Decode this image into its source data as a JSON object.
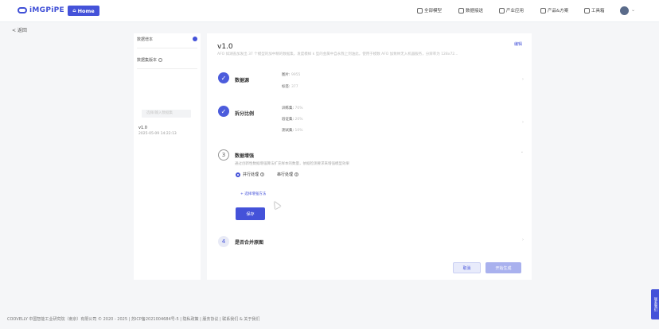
{
  "header": {
    "logo_text": "iMGPiPE",
    "home_label": "Home",
    "nav": [
      {
        "label": "全部模型",
        "icon": "model-icon"
      },
      {
        "label": "数据接送",
        "icon": "data-icon"
      },
      {
        "label": "产业应用",
        "icon": "industry-icon"
      },
      {
        "label": "产品&方案",
        "icon": "product-icon"
      },
      {
        "label": "工具箱",
        "icon": "toolbox-icon"
      }
    ]
  },
  "back_label": "< 返回",
  "sidebar": {
    "item1": "数据增本",
    "item2": "数据集版本",
    "input_placeholder": "选择/输入数据集",
    "version_name": "v1.0",
    "version_time": "2025-05-09 14:22:13"
  },
  "main": {
    "version_title": "v1.0",
    "edit_label": "编辑",
    "description": "AFO 如湖盖加发出 37 个模型的加中精的数据集，发度模样 k 型的金属中自永我上到油此，使用于模数 AFO 加致林无入机器服务，分辨率为 128x72...",
    "steps": [
      {
        "title": "数据源",
        "rows": [
          {
            "k": "图片:",
            "v": "9955"
          },
          {
            "k": "标签:",
            "v": "377"
          }
        ]
      },
      {
        "title": "拆分比例",
        "rows": [
          {
            "k": "训练集:",
            "v": "70%"
          },
          {
            "k": "验证集:",
            "v": "20%"
          },
          {
            "k": "测试集:",
            "v": "10%"
          }
        ]
      },
      {
        "num": "3",
        "title": "数据增强",
        "hint": "通过创新性数据增强算法扩充样本的数量，依据检测要求来增强模型效果"
      },
      {
        "num": "4",
        "title": "是否合并原图"
      }
    ],
    "radio_parallel": "并行处理",
    "radio_serial": "串行处理",
    "add_method": "+ 选择增强方法",
    "save_label": "保存",
    "cancel_label": "取消",
    "generate_label": "开始生成"
  },
  "footer": "COOVELLY  中国智能工业研究院（南京）有限公司 © 2020 - 2025 | 苏ICP备2021004684号-5 | 隐私政策 | 服务协议 | 联系我们 & 关于我们",
  "float_tab": "联系我们"
}
